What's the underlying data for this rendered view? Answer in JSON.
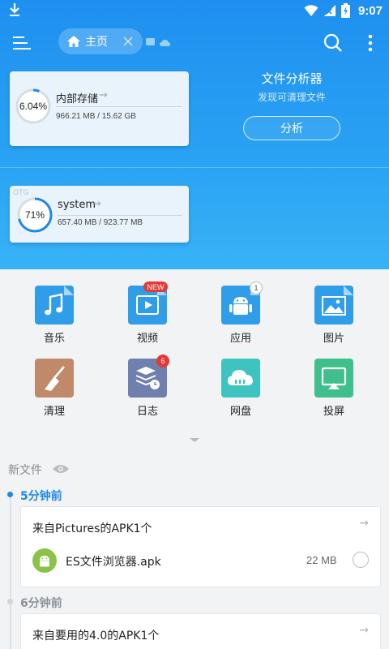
{
  "status_bar": {
    "time": "9:07"
  },
  "toolbar": {
    "home_tab": "主页"
  },
  "storage": [
    {
      "name": "内部存储",
      "percent_label": "6.04%",
      "percent": 6.04,
      "size": "966.21 MB / 15.62 GB"
    },
    {
      "tag": "OTG",
      "name": "system",
      "percent_label": "71%",
      "percent": 71,
      "size": "657.40 MB / 923.77 MB"
    }
  ],
  "analyzer": {
    "title": "文件分析器",
    "subtitle": "发现可清理文件",
    "button": "分析"
  },
  "categories": [
    {
      "label": "音乐",
      "icon": "music-note-icon",
      "color": "#2f9de8"
    },
    {
      "label": "视频",
      "icon": "video-play-icon",
      "color": "#2f9de8",
      "badge": "NEW"
    },
    {
      "label": "应用",
      "icon": "android-icon",
      "color": "#2f9de8",
      "badge": "1"
    },
    {
      "label": "图片",
      "icon": "picture-icon",
      "color": "#2f9de8"
    },
    {
      "label": "清理",
      "icon": "broom-icon",
      "color": "#c08a6a"
    },
    {
      "label": "日志",
      "icon": "log-stack-icon",
      "color": "#6f7fae",
      "badge": "6"
    },
    {
      "label": "网盘",
      "icon": "cloud-drive-icon",
      "color": "#3fc3c1"
    },
    {
      "label": "投屏",
      "icon": "cast-screen-icon",
      "color": "#3fbf8c"
    }
  ],
  "recent": {
    "heading": "新文件",
    "groups": [
      {
        "time": "5分钟前",
        "title": "来自Pictures的APK1个",
        "file_name": "ES文件浏览器.apk",
        "file_size": "22 MB"
      },
      {
        "time": "6分钟前",
        "title": "来自要用的4.0的APK1个"
      }
    ]
  },
  "colors": {
    "accent": "#1e8ff0",
    "timeline_active": "#1e88e5"
  }
}
